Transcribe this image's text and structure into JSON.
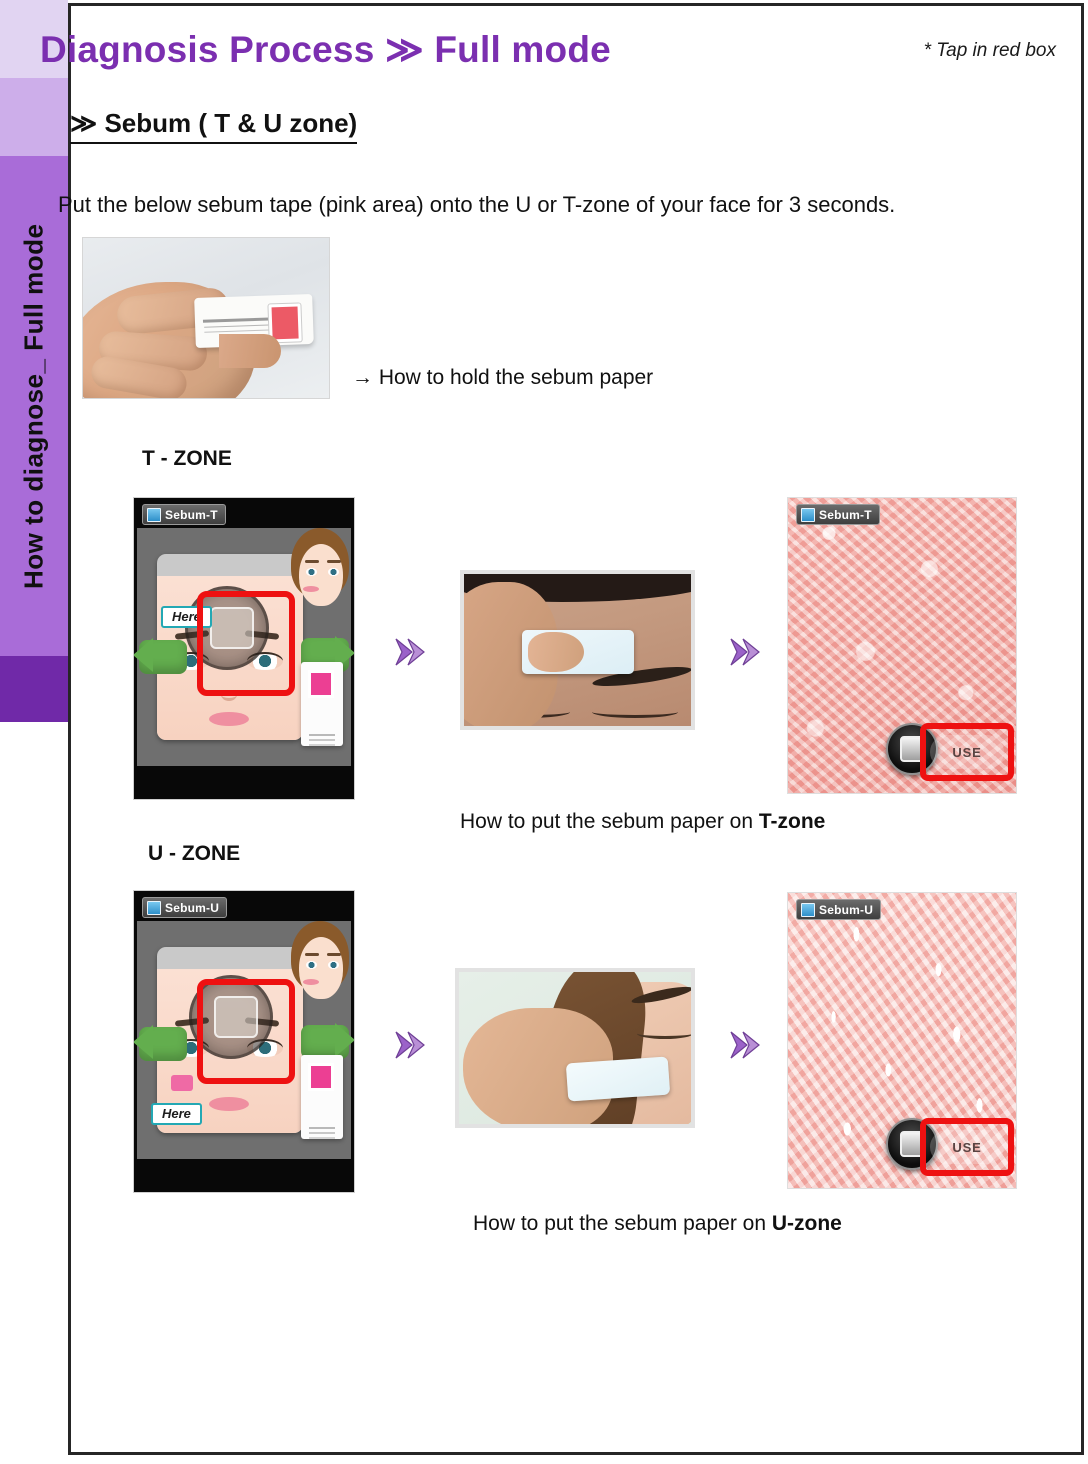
{
  "sidebar": {
    "label": "How to diagnose_ Full mode",
    "bands": [
      "#e1d4f2",
      "#cdaeea",
      "#a96cd8",
      "#7029a8"
    ]
  },
  "header": {
    "title": "Diagnosis Process ≫ Full mode",
    "title_color": "#7b2fb0",
    "note": "* Tap in red box"
  },
  "section": {
    "heading": "≫ Sebum ( T & U zone)"
  },
  "intro": {
    "text": "Put the below sebum tape (pink area) onto the U or T-zone of your face for 3 seconds."
  },
  "hold": {
    "caption": "→ How to hold the sebum paper"
  },
  "t_zone": {
    "label": "T - ZONE",
    "app_badge": "Sebum-T",
    "here_tag": "Here",
    "use_label": "USE",
    "caption_prefix": "How to put the sebum paper on ",
    "caption_strong": "T-zone"
  },
  "u_zone": {
    "label": "U - ZONE",
    "app_badge": "Sebum-U",
    "here_tag": "Here",
    "use_label": "USE",
    "caption_prefix": "How to put the sebum paper on ",
    "caption_strong": "U-zone"
  },
  "colors": {
    "accent_purple": "#7b2fb0",
    "red_highlight": "#ee1111",
    "chevron_purple": "#9b62c9",
    "teal_tag_border": "#23a8b4"
  }
}
